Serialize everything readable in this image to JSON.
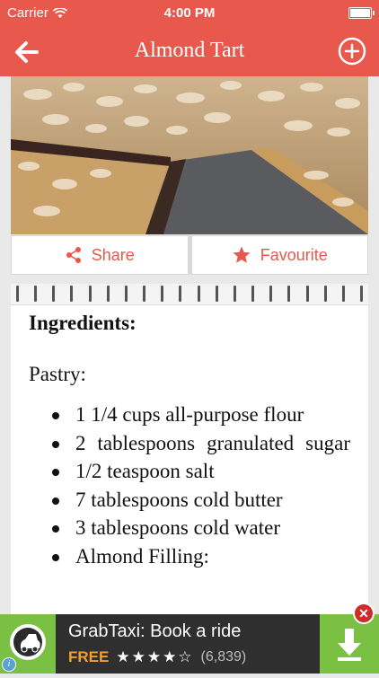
{
  "status_bar": {
    "carrier": "Carrier",
    "time": "4:00 PM"
  },
  "nav": {
    "title": "Almond Tart"
  },
  "actions": {
    "share_label": "Share",
    "favourite_label": "Favourite"
  },
  "recipe": {
    "heading": "Ingredients:",
    "pastry_label": "Pastry:",
    "items": [
      "1 1/4 cups all-purpose flour",
      "2 tablespoons granulated sugar",
      "1/2 teaspoon salt",
      "7 tablespoons cold butter",
      "3 tablespoons cold water",
      "Almond Filling:"
    ]
  },
  "ad": {
    "app_name": "GrabTaxi: Book a ride",
    "price": "FREE",
    "stars": "★★★★☆",
    "rating": 4.5,
    "reviews": "(6,839)",
    "info_glyph": "i",
    "close_glyph": "✕"
  },
  "colors": {
    "accent": "#e8584d",
    "ad_green": "#7ac143",
    "ad_dark": "#2f2f2f"
  }
}
